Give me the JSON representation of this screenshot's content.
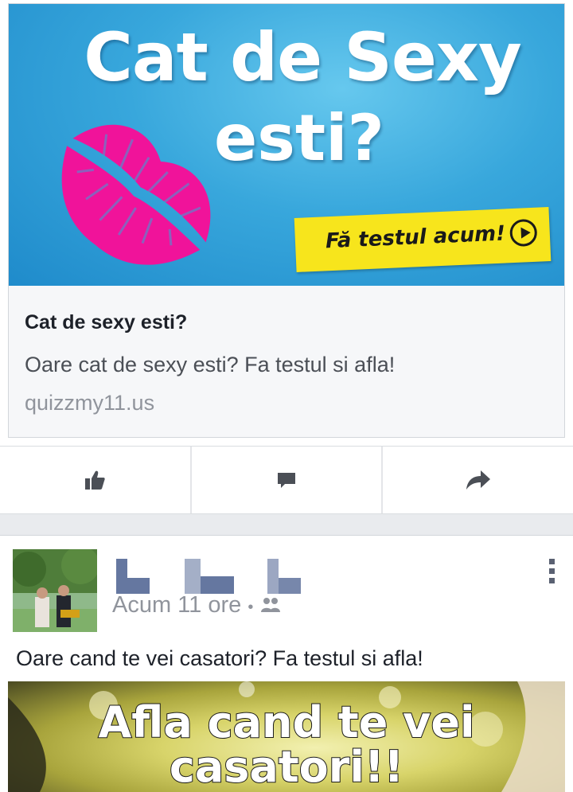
{
  "ad_card": {
    "banner_line1": "Cat de Sexy",
    "banner_line2": "esti?",
    "cta_label": "Fă testul acum!",
    "title": "Cat de sexy esti?",
    "description": "Oare cat de sexy esti? Fa testul si afla!",
    "domain": "quizzmy11.us",
    "colors": {
      "banner_blue": "#38a7dc",
      "lips_pink": "#f0139a",
      "cta_yellow": "#f7e51c"
    }
  },
  "action_bar": {
    "icons": [
      "like-icon",
      "comment-icon",
      "share-icon"
    ]
  },
  "post": {
    "timestamp": "Acum 11 ore",
    "separator": "•",
    "privacy_icon": "friends-icon",
    "text": "Oare cand te vei casatori? Fa testul si afla!",
    "image_line1": "Afla cand te vei",
    "image_line2": "casatori!!"
  }
}
